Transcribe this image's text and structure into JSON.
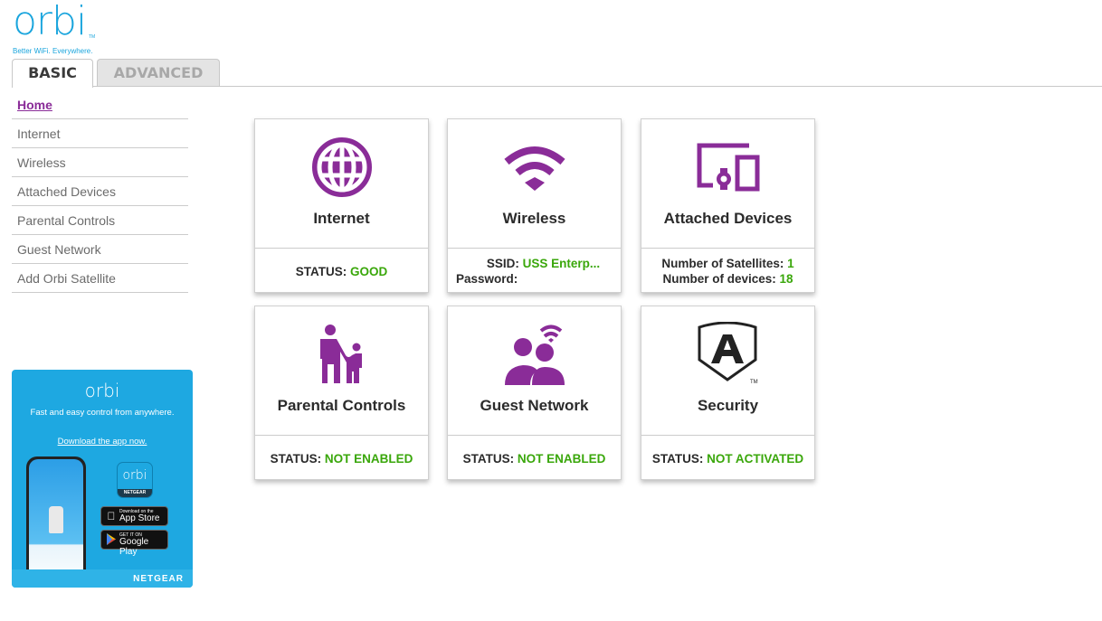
{
  "brand": {
    "logo_text": "orbi",
    "trademark": "TM",
    "tagline": "Better WiFi. Everywhere."
  },
  "tabs": [
    {
      "label": "BASIC",
      "active": true
    },
    {
      "label": "ADVANCED",
      "active": false
    }
  ],
  "sidebar": {
    "items": [
      {
        "label": "Home",
        "active": true
      },
      {
        "label": "Internet"
      },
      {
        "label": "Wireless"
      },
      {
        "label": "Attached Devices"
      },
      {
        "label": "Parental Controls"
      },
      {
        "label": "Guest Network"
      },
      {
        "label": "Add Orbi Satellite"
      }
    ]
  },
  "promo": {
    "logo": "orbi",
    "text": "Fast and easy control from anywhere.",
    "link": "Download the app now.",
    "app_icon_word": "orbi",
    "app_icon_brand": "NETGEAR",
    "app_store": {
      "small": "Download on the",
      "big": "App Store"
    },
    "google_play": {
      "small": "GET IT ON",
      "big": "Google Play"
    },
    "brand": "NETGEAR"
  },
  "colors": {
    "accent_purple": "#8a2c98",
    "status_green": "#3aa70b",
    "brand_blue": "#1aa5dd"
  },
  "tiles": {
    "internet": {
      "title": "Internet",
      "icon": "globe-icon",
      "status_label": "STATUS:",
      "status_value": "GOOD"
    },
    "wireless": {
      "title": "Wireless",
      "icon": "wifi-icon",
      "ssid_label": "SSID:",
      "ssid_value": "USS Enterp...",
      "password_label": "Password:",
      "password_value": ""
    },
    "devices": {
      "title": "Attached Devices",
      "icon": "devices-icon",
      "satellites_label": "Number of Satellites:",
      "satellites_value": "1",
      "devices_label": "Number of devices:",
      "devices_value": "18"
    },
    "parental": {
      "title": "Parental Controls",
      "icon": "parent-child-icon",
      "status_label": "STATUS:",
      "status_value": "NOT ENABLED"
    },
    "guest": {
      "title": "Guest Network",
      "icon": "guest-users-icon",
      "status_label": "STATUS:",
      "status_value": "NOT ENABLED"
    },
    "security": {
      "title": "Security",
      "icon": "armor-shield-icon",
      "trademark": "TM",
      "status_label": "STATUS:",
      "status_value": "NOT ACTIVATED"
    }
  }
}
